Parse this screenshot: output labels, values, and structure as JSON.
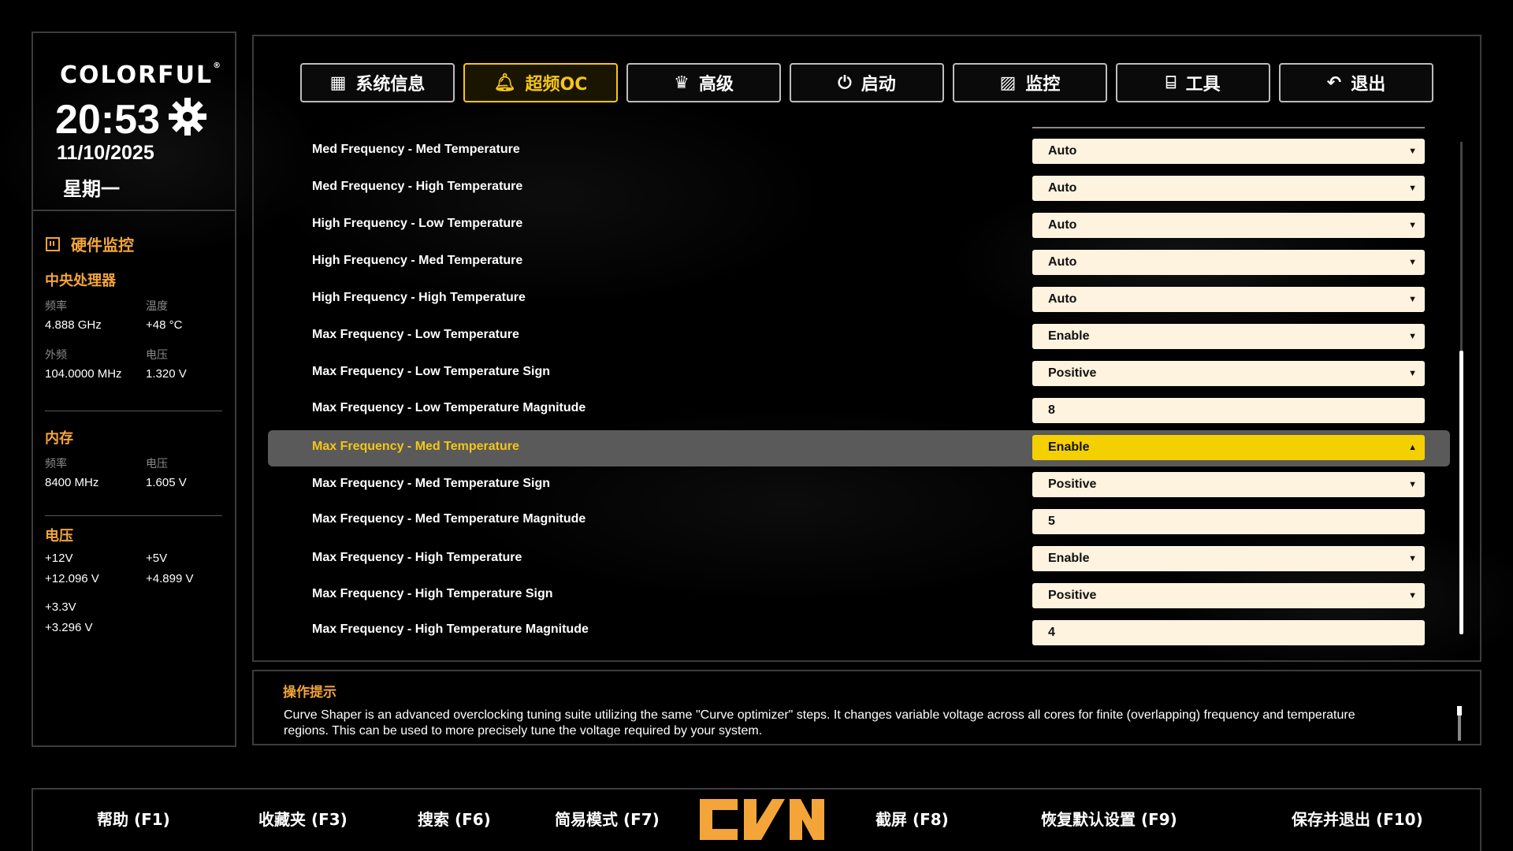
{
  "brand": {
    "logo": "COLORFUL",
    "registered": "®"
  },
  "clock": {
    "time": "20:53",
    "date": "11/10/2025",
    "weekday": "星期一"
  },
  "monitor": {
    "title": "硬件监控",
    "cpu": {
      "title": "中央处理器",
      "freq_label": "频率",
      "freq": "4.888 GHz",
      "temp_label": "温度",
      "temp": "+48 °C",
      "bclk_label": "外频",
      "bclk": "104.0000 MHz",
      "volt_label": "电压",
      "volt": "1.320 V"
    },
    "memory": {
      "title": "内存",
      "freq_label": "频率",
      "freq": "8400 MHz",
      "volt_label": "电压",
      "volt": "1.605 V"
    },
    "voltage": {
      "title": "电压",
      "v12_label": "+12V",
      "v12": "+12.096 V",
      "v5_label": "+5V",
      "v5": "+4.899 V",
      "v33_label": "+3.3V",
      "v33": "+3.296 V"
    }
  },
  "tabs": [
    {
      "label": "系统信息",
      "icon": "grid-icon"
    },
    {
      "label": "超频OC",
      "icon": "bell-icon"
    },
    {
      "label": "高级",
      "icon": "crown-icon"
    },
    {
      "label": "启动",
      "icon": "power-icon"
    },
    {
      "label": "监控",
      "icon": "monitor-icon"
    },
    {
      "label": "工具",
      "icon": "toolbox-icon"
    },
    {
      "label": "退出",
      "icon": "back-icon"
    }
  ],
  "active_tab": "超频OC",
  "settings": [
    {
      "label": "Med Frequency - Med Temperature",
      "value": "Auto",
      "type": "dropdown"
    },
    {
      "label": "Med Frequency - High Temperature",
      "value": "Auto",
      "type": "dropdown"
    },
    {
      "label": "High Frequency - Low Temperature",
      "value": "Auto",
      "type": "dropdown"
    },
    {
      "label": "High Frequency - Med Temperature",
      "value": "Auto",
      "type": "dropdown"
    },
    {
      "label": "High Frequency - High Temperature",
      "value": "Auto",
      "type": "dropdown"
    },
    {
      "label": "Max Frequency - Low Temperature",
      "value": "Enable",
      "type": "dropdown"
    },
    {
      "label": "Max Frequency - Low Temperature Sign",
      "value": "Positive",
      "type": "dropdown"
    },
    {
      "label": "Max Frequency - Low Temperature Magnitude",
      "value": "8",
      "type": "input"
    },
    {
      "label": "Max Frequency - Med Temperature",
      "value": "Enable",
      "type": "dropdown",
      "selected": true
    },
    {
      "label": "Max Frequency - Med Temperature Sign",
      "value": "Positive",
      "type": "dropdown"
    },
    {
      "label": "Max Frequency - Med Temperature Magnitude",
      "value": "5",
      "type": "input"
    },
    {
      "label": "Max Frequency - High Temperature",
      "value": "Enable",
      "type": "dropdown"
    },
    {
      "label": "Max Frequency - High Temperature Sign",
      "value": "Positive",
      "type": "dropdown"
    },
    {
      "label": "Max Frequency - High Temperature Magnitude",
      "value": "4",
      "type": "input"
    }
  ],
  "help": {
    "title": "操作提示",
    "text": "Curve Shaper is an advanced overclocking tuning suite utilizing the same \"Curve optimizer\" steps. It changes variable voltage across all cores for finite (overlapping) frequency and temperature regions. This can be used to more precisely tune the voltage required by your system."
  },
  "footer": {
    "help": "帮助 (F1)",
    "favorites": "收藏夹 (F3)",
    "search": "搜索 (F6)",
    "easy_mode": "简易模式 (F7)",
    "logo": "CVN",
    "screenshot": "截屏 (F8)",
    "defaults": "恢复默认设置 (F9)",
    "save_exit": "保存并退出 (F10)"
  },
  "colors": {
    "accent": "#f5c518",
    "orange": "#f3a53a",
    "field_bg": "#fdf3df",
    "selected_row": "#5a5a5a"
  }
}
